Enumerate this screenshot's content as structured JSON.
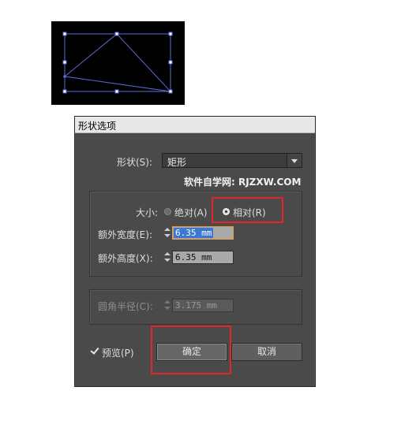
{
  "dialog": {
    "title": "形状选项",
    "shape_label": "形状(S):",
    "shape_value": "矩形",
    "watermark": "软件自学网: RJZXW.COM",
    "size_label": "大小:",
    "size_options": [
      {
        "label": "绝对(A)",
        "selected": false
      },
      {
        "label": "相对(R)",
        "selected": true
      }
    ],
    "extra_width_label": "额外宽度(E):",
    "extra_width_value": "6.35 mm",
    "extra_height_label": "额外高度(X):",
    "extra_height_value": "6.35 mm",
    "corner_radius_label": "圆角半径(C):",
    "corner_radius_value": "3.175 mm",
    "preview_label": "预览(P)",
    "preview_checked": true,
    "ok_label": "确定",
    "cancel_label": "取消"
  },
  "colors": {
    "highlight": "#e0262a",
    "path": "#5b6bd8",
    "selection": "#3b78d6"
  }
}
